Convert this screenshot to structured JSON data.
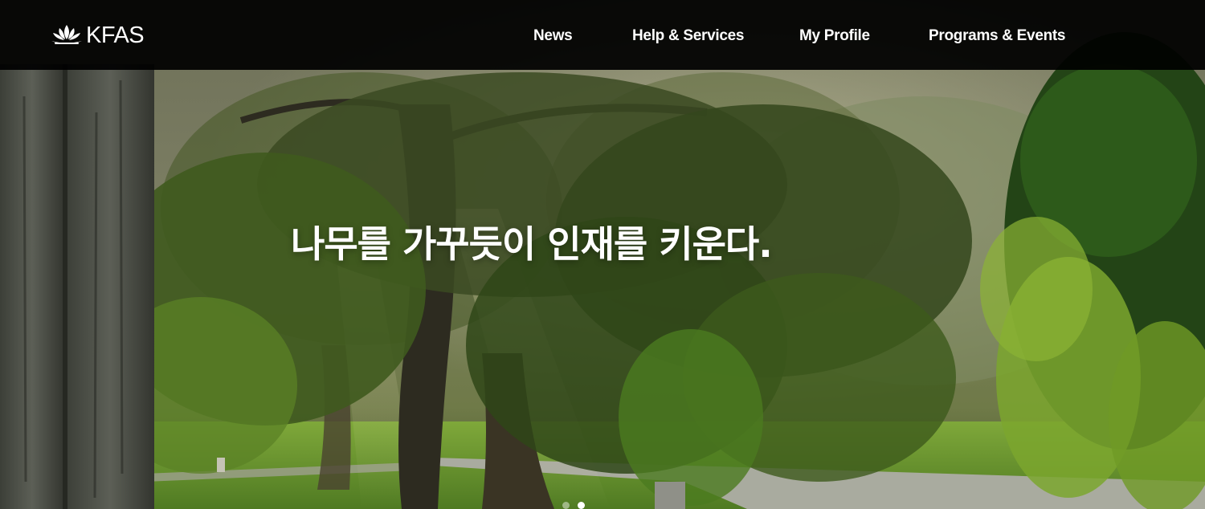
{
  "brand": {
    "name": "KFAS",
    "logo_icon": "lotus-leaves-icon"
  },
  "nav": {
    "items": [
      {
        "label": "News"
      },
      {
        "label": "Help & Services"
      },
      {
        "label": "My Profile"
      },
      {
        "label": "Programs & Events"
      }
    ]
  },
  "hero": {
    "headline": "나무를 가꾸듯이 인재를 키운다.",
    "slider_dot_count": 2,
    "active_slide": 2
  },
  "colors": {
    "topbar": "#000000",
    "text": "#ffffff"
  }
}
